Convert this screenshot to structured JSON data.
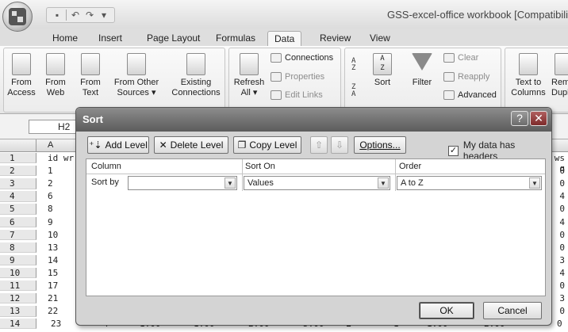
{
  "window": {
    "title": "GSS-excel-office workbook  [Compatibility Mo"
  },
  "quick_access": {
    "save_icon": "save-icon",
    "undo": "↶",
    "redo": "↷",
    "customize": "▾"
  },
  "tabs": [
    "Home",
    "Insert",
    "Page Layout",
    "Formulas",
    "Data",
    "Review",
    "View"
  ],
  "active_tab": "Data",
  "ribbon": {
    "from_access": [
      "From",
      "Access"
    ],
    "from_web": [
      "From",
      "Web"
    ],
    "from_text": [
      "From",
      "Text"
    ],
    "from_other": [
      "From Other",
      "Sources ▾"
    ],
    "existing": [
      "Existing",
      "Connections"
    ],
    "refresh": [
      "Refresh",
      "All ▾"
    ],
    "connections": "Connections",
    "properties": "Properties",
    "edit_links": "Edit Links",
    "sort_az": "A\nZ",
    "sort_za": "Z\nA",
    "sort_label": "Sort",
    "filter": "Filter",
    "clear": "Clear",
    "reapply": "Reapply",
    "advanced": "Advanced",
    "text_to_columns": [
      "Text to",
      "Columns"
    ],
    "remove_dup": [
      "Rem",
      "Dupl"
    ]
  },
  "namebox": "H2",
  "sheet": {
    "col_a": "A",
    "rows": [
      {
        "n": "1",
        "a": "id wr",
        "r": "ws q"
      },
      {
        "n": "2",
        "a": "1",
        "r": "0"
      },
      {
        "n": "3",
        "a": "2",
        "r": "0"
      },
      {
        "n": "4",
        "a": "6",
        "r": "4"
      },
      {
        "n": "5",
        "a": "8",
        "r": "0"
      },
      {
        "n": "6",
        "a": "9",
        "r": "4"
      },
      {
        "n": "7",
        "a": "10",
        "r": "0"
      },
      {
        "n": "8",
        "a": "13",
        "r": "0"
      },
      {
        "n": "9",
        "a": "14",
        "r": "3"
      },
      {
        "n": "10",
        "a": "15",
        "r": "4"
      },
      {
        "n": "11",
        "a": "17",
        "r": "0"
      },
      {
        "n": "12",
        "a": "21",
        "r": "3"
      },
      {
        "n": "13",
        "a": "22",
        "r": "0"
      }
    ],
    "row14": {
      "n": "14",
      "cells": [
        "23",
        "4",
        "1.00",
        "1.00",
        "2.00",
        "5.00",
        "1",
        "1",
        "1.00",
        "2.00",
        "0"
      ]
    }
  },
  "dialog": {
    "title": "Sort",
    "help": "?",
    "close": "✕",
    "add_level": "Add Level",
    "delete_level": "Delete Level",
    "copy_level": "Copy Level",
    "move_up": "⇧",
    "move_down": "⇩",
    "options": "Options...",
    "headers_checked": "✓",
    "headers_label": "My data has headers",
    "col_header": "Column",
    "sorton_header": "Sort On",
    "order_header": "Order",
    "sort_by": "Sort by",
    "column_value": "",
    "sorton_value": "Values",
    "order_value": "A to Z",
    "ok": "OK",
    "cancel": "Cancel"
  }
}
